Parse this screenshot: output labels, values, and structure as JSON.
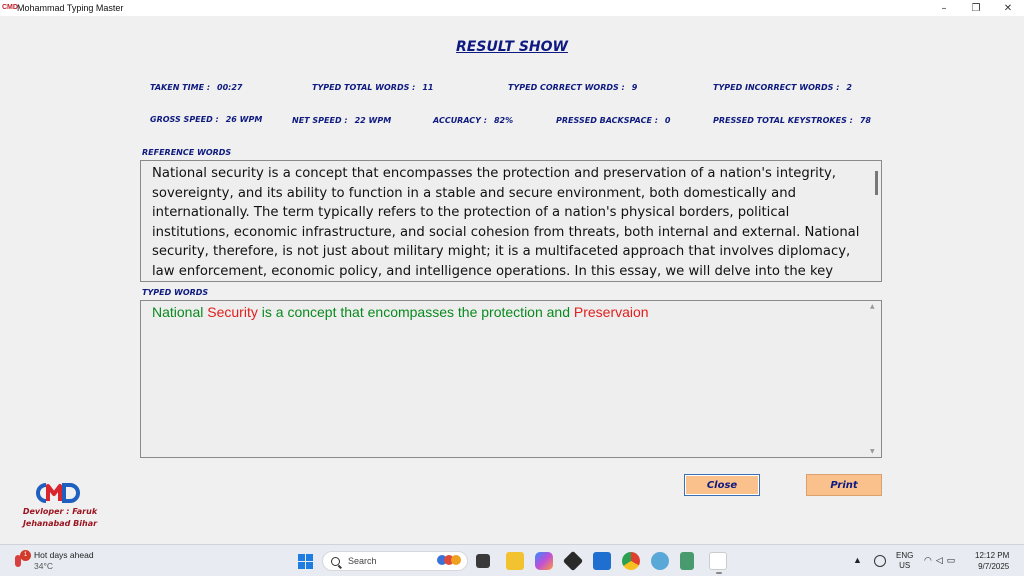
{
  "window": {
    "title": "Mohammad Typing Master",
    "logo_text": "CMD",
    "minimize_glyph": "–",
    "restore_glyph": "❐",
    "close_glyph": "✕"
  },
  "heading": "RESULT SHOW",
  "stats": {
    "taken_time": {
      "label": "TAKEN TIME :",
      "value": "00:27"
    },
    "typed_total_words": {
      "label": "TYPED TOTAL WORDS :",
      "value": "11"
    },
    "typed_correct_words": {
      "label": "TYPED CORRECT WORDS :",
      "value": "9"
    },
    "typed_incorrect_words": {
      "label": "TYPED INCORRECT WORDS :",
      "value": "2"
    },
    "gross_speed": {
      "label": "GROSS SPEED :",
      "value": "26 WPM"
    },
    "net_speed": {
      "label": "NET SPEED :",
      "value": "22 WPM"
    },
    "accuracy": {
      "label": "ACCURACY :",
      "value": "82%"
    },
    "pressed_backspace": {
      "label": "PRESSED BACKSPACE :",
      "value": "0"
    },
    "pressed_total_keystrokes": {
      "label": "PRESSED TOTAL KEYSTROKES :",
      "value": "78"
    }
  },
  "reference": {
    "label": "REFERENCE WORDS",
    "text": "National security is a concept that encompasses the protection and preservation of a nation's integrity, sovereignty, and its ability to function in a stable and secure environment, both domestically and internationally. The term typically refers to the protection of a nation's physical borders, political institutions, economic infrastructure, and social cohesion from threats, both internal and external. National security, therefore, is not just about military might; it is a multifaceted approach that involves diplomacy, law enforcement, economic policy, and intelligence operations. In this essay, we will delve into the key elements that define national"
  },
  "typed": {
    "label": "TYPED WORDS",
    "words": [
      {
        "text": "National",
        "correct": true
      },
      {
        "text": "Security",
        "correct": false
      },
      {
        "text": "is",
        "correct": true
      },
      {
        "text": "a",
        "correct": true
      },
      {
        "text": "concept",
        "correct": true
      },
      {
        "text": "that",
        "correct": true
      },
      {
        "text": "encompasses",
        "correct": true
      },
      {
        "text": "the",
        "correct": true
      },
      {
        "text": "protection",
        "correct": true
      },
      {
        "text": "and",
        "correct": true
      },
      {
        "text": "Preservaion",
        "correct": false
      }
    ]
  },
  "buttons": {
    "close": "Close",
    "print": "Print"
  },
  "developer": {
    "logo_text": "CMD",
    "line1": "Devloper : Faruk",
    "line2": "Jehanabad Bihar"
  },
  "taskbar": {
    "weather_badge": "1",
    "weather_title": "Hot days ahead",
    "weather_temp": "34°C",
    "search_placeholder": "Search",
    "apps": [
      "file-explorer-icon",
      "copilot-icon",
      "capcut-icon",
      "store-icon",
      "chrome-icon",
      "network-icon",
      "notepad-icon",
      "typing-master-icon"
    ],
    "lang_line1": "ENG",
    "lang_line2": "US",
    "time": "12:12 PM",
    "date": "9/7/2025"
  },
  "colors": {
    "heading": "#0e1a80",
    "correct_word": "#0a8a1e",
    "incorrect_word": "#e0201e",
    "button_fill": "#fbc18d",
    "developer_text": "#9b1420"
  }
}
